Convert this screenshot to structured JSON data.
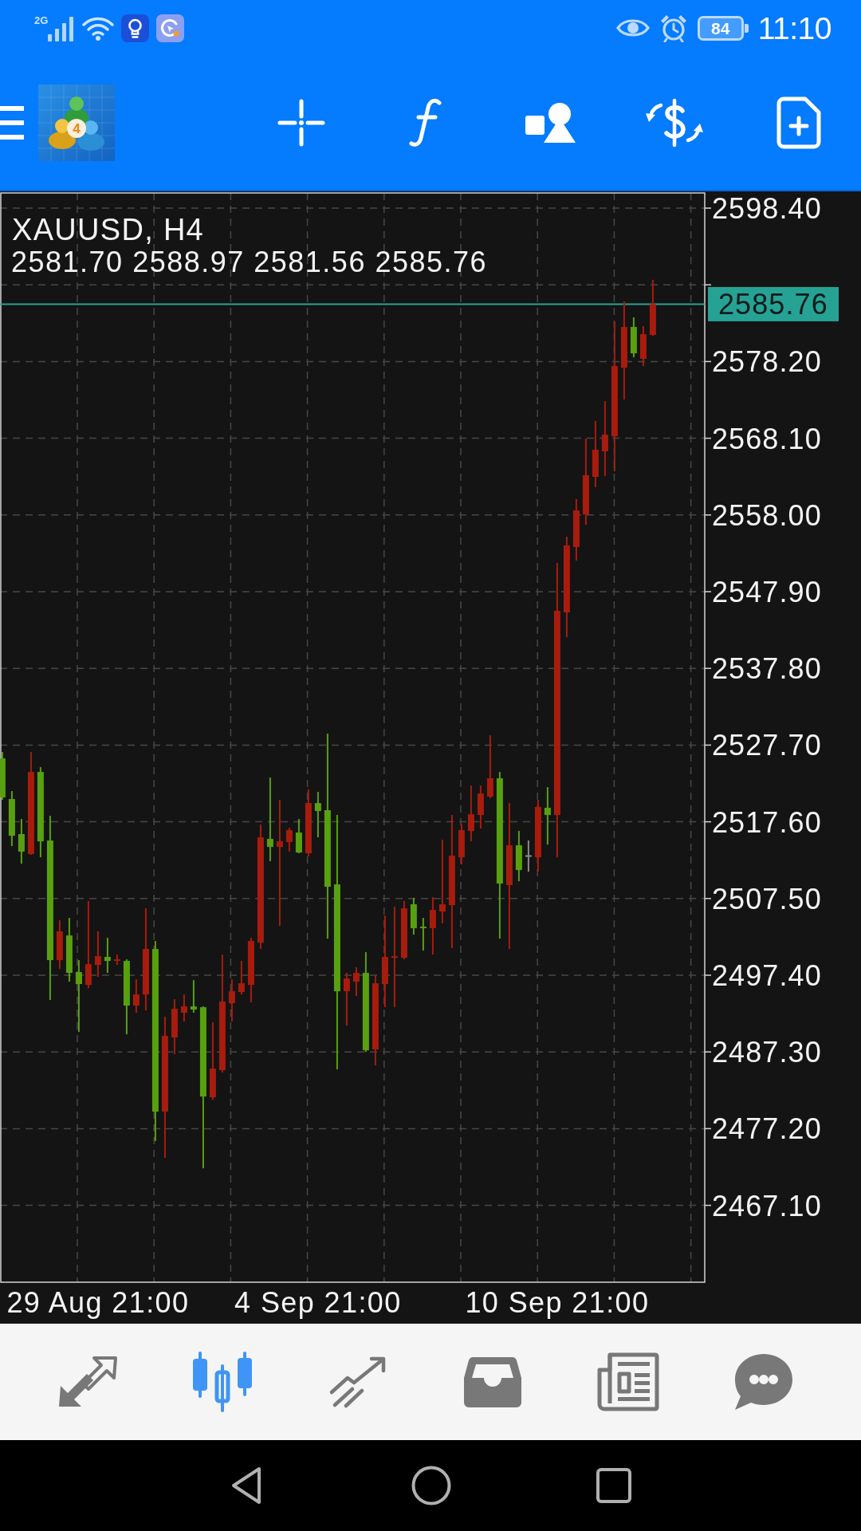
{
  "status_bar": {
    "network": "2G",
    "battery": "84",
    "time": "11:10"
  },
  "toolbar": {
    "logo_badge": "4",
    "tools": [
      {
        "kind": "crosshair"
      },
      {
        "kind": "indicators"
      },
      {
        "kind": "objects"
      },
      {
        "kind": "trade"
      },
      {
        "kind": "newchart"
      }
    ]
  },
  "chart": {
    "chart_data": {
      "type": "candlestick",
      "title": "XAUUSD, H4",
      "grid": true,
      "categories": [
        null,
        null,
        null,
        null,
        null,
        null,
        null,
        null,
        null,
        null,
        "29 Aug 21:00",
        null,
        null,
        null,
        null,
        null,
        null,
        null,
        null,
        null,
        null,
        null,
        null,
        null,
        null,
        null,
        null,
        null,
        null,
        null,
        null,
        null,
        null,
        "4 Sep 21:00",
        null,
        null,
        null,
        null,
        null,
        null,
        null,
        null,
        null,
        null,
        null,
        null,
        null,
        null,
        null,
        null,
        null,
        null,
        null,
        null,
        null,
        null,
        null,
        null,
        "10 Sep 21:00",
        null,
        null,
        null,
        null,
        null,
        null,
        null,
        null,
        null,
        null
      ],
      "ohlc": [
        [
          2525.95,
          2526.79,
          2520.49,
          2520.81
        ],
        [
          2520.6,
          2521.65,
          2514.4,
          2515.77
        ],
        [
          2515.98,
          2517.97,
          2512.09,
          2513.67
        ],
        [
          2513.35,
          2526.79,
          2513.25,
          2524.17
        ],
        [
          2524.17,
          2524.8,
          2512.93,
          2515.03
        ],
        [
          2515.14,
          2518.39,
          2494.14,
          2499.39
        ],
        [
          2499.39,
          2504.64,
          2498.23,
          2503.17
        ],
        [
          2502.64,
          2504.95,
          2496.55,
          2497.71
        ],
        [
          2497.81,
          2499.39,
          2489.94,
          2496.24
        ],
        [
          2496.13,
          2507.16,
          2495.71,
          2498.86
        ],
        [
          2498.76,
          2503.17,
          2497.18,
          2499.91
        ],
        [
          2499.81,
          2502.33,
          2497.71,
          2499.28
        ],
        [
          2499.28,
          2500.12,
          2498.76,
          2499.49
        ],
        [
          2499.28,
          2499.49,
          2489.62,
          2493.4
        ],
        [
          2493.4,
          2496.87,
          2492.46,
          2494.87
        ],
        [
          2494.87,
          2506.21,
          2492.77,
          2500.86
        ],
        [
          2500.86,
          2501.91,
          2475.55,
          2479.44
        ],
        [
          2479.44,
          2491.93,
          2473.35,
          2489.41
        ],
        [
          2489.2,
          2494.24,
          2487.0,
          2492.98
        ],
        [
          2492.46,
          2494.87,
          2491.3,
          2493.3
        ],
        [
          2493.3,
          2496.76,
          2492.46,
          2492.88
        ],
        [
          2493.19,
          2493.3,
          2471.98,
          2481.43
        ],
        [
          2481.33,
          2491.2,
          2481.01,
          2485.11
        ],
        [
          2484.9,
          2500.12,
          2484.58,
          2493.93
        ],
        [
          2493.72,
          2496.87,
          2491.3,
          2495.29
        ],
        [
          2495.19,
          2499.28,
          2494.87,
          2496.34
        ],
        [
          2496.13,
          2502.33,
          2493.82,
          2501.91
        ],
        [
          2501.7,
          2517.24,
          2500.86,
          2515.56
        ],
        [
          2515.35,
          2523.43,
          2512.41,
          2514.3
        ],
        [
          2514.3,
          2520.49,
          2503.9,
          2515.03
        ],
        [
          2514.93,
          2516.82,
          2513.67,
          2516.5
        ],
        [
          2516.19,
          2517.97,
          2513.46,
          2513.56
        ],
        [
          2513.46,
          2521.86,
          2513.04,
          2520.07
        ],
        [
          2520.07,
          2521.54,
          2515.56,
          2519.02
        ],
        [
          2519.13,
          2529.21,
          2502.22,
          2509.05
        ],
        [
          2509.36,
          2518.5,
          2485.0,
          2495.29
        ],
        [
          2495.29,
          2497.71,
          2490.78,
          2496.97
        ],
        [
          2496.55,
          2498.44,
          2494.66,
          2497.71
        ],
        [
          2497.71,
          2500.44,
          2487.31,
          2487.52
        ],
        [
          2487.63,
          2497.39,
          2485.53,
          2496.34
        ],
        [
          2496.24,
          2505.27,
          2493.19,
          2499.81
        ],
        [
          2499.7,
          2506.42,
          2493.19,
          2499.91
        ],
        [
          2499.7,
          2507.16,
          2499.49,
          2506.21
        ],
        [
          2506.74,
          2507.58,
          2502.75,
          2503.59
        ],
        [
          2503.8,
          2504.95,
          2500.65,
          2503.59
        ],
        [
          2503.59,
          2507.68,
          2500.12,
          2506.0
        ],
        [
          2505.79,
          2515.24,
          2504.22,
          2506.74
        ],
        [
          2506.63,
          2518.5,
          2500.96,
          2513.14
        ],
        [
          2512.93,
          2517.34,
          2511.99,
          2516.5
        ],
        [
          2516.4,
          2522.38,
          2515.03,
          2518.6
        ],
        [
          2518.5,
          2522.38,
          2516.71,
          2521.33
        ],
        [
          2520.91,
          2528.99,
          2520.7,
          2523.33
        ],
        [
          2523.33,
          2524.17,
          2502.22,
          2509.47
        ],
        [
          2509.26,
          2520.07,
          2500.86,
          2514.51
        ],
        [
          2514.51,
          2516.4,
          2509.78,
          2511.25
        ],
        [
          2513.2,
          2515.14,
          2511.04,
          2513.2
        ],
        [
          2512.93,
          2520.49,
          2511.04,
          2519.55
        ],
        [
          2519.44,
          2522.17,
          2514.61,
          2518.5
        ],
        [
          2518.5,
          2551.68,
          2512.93,
          2545.38
        ],
        [
          2545.17,
          2555.14,
          2541.91,
          2553.99
        ],
        [
          2553.78,
          2560.08,
          2551.99,
          2558.61
        ],
        [
          2558.08,
          2568.06,
          2556.72,
          2563.23
        ],
        [
          2563.02,
          2570.37,
          2561.65,
          2566.59
        ],
        [
          2566.38,
          2572.99,
          2563.12,
          2568.58
        ],
        [
          2568.37,
          2583.49,
          2563.75,
          2577.61
        ],
        [
          2577.4,
          2586.12,
          2573.2,
          2582.76
        ],
        [
          2582.76,
          2584.02,
          2578.77,
          2579.29
        ],
        [
          2578.56,
          2582.86,
          2577.61,
          2581.81
        ],
        [
          2581.7,
          2588.97,
          2581.56,
          2585.76
        ]
      ],
      "ylim": [
        2456.98,
        2600.4
      ],
      "yticks": [
        {
          "value": 2598.4,
          "label": "2598.40"
        },
        {
          "value": 2578.2,
          "label": "2578.20"
        },
        {
          "value": 2568.1,
          "label": "2568.10"
        },
        {
          "value": 2558.0,
          "label": "2558.00"
        },
        {
          "value": 2547.9,
          "label": "2547.90"
        },
        {
          "value": 2537.8,
          "label": "2537.80"
        },
        {
          "value": 2527.7,
          "label": "2527.70"
        },
        {
          "value": 2517.6,
          "label": "2517.60"
        },
        {
          "value": 2507.5,
          "label": "2507.50"
        },
        {
          "value": 2497.4,
          "label": "2497.40"
        },
        {
          "value": 2487.3,
          "label": "2487.30"
        },
        {
          "value": 2477.2,
          "label": "2477.20"
        },
        {
          "value": 2467.1,
          "label": "2467.10"
        }
      ],
      "ref_lines": [
        {
          "axis": "y",
          "value": 2585.76,
          "label": "2585.76"
        }
      ]
    },
    "ohlc_text": "2581.70 2588.97 2581.56 2585.76"
  },
  "bottom_nav": [
    {
      "kind": "quotes",
      "selected": false
    },
    {
      "kind": "chart",
      "selected": true
    },
    {
      "kind": "trade",
      "selected": false
    },
    {
      "kind": "history",
      "selected": false
    },
    {
      "kind": "news",
      "selected": false
    },
    {
      "kind": "chat",
      "selected": false
    }
  ]
}
